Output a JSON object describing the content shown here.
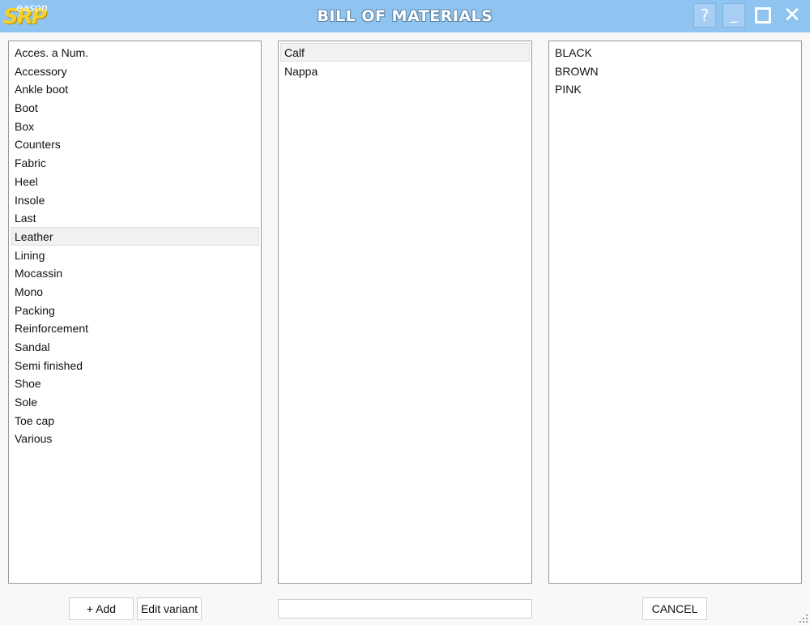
{
  "window": {
    "title": "BILL OF MATERIALS",
    "logo_main": "SRP",
    "logo_sub": "eason",
    "help_label": "?",
    "minimize_label": "_",
    "close_label": "✕"
  },
  "categories": {
    "items": [
      "Acces. a Num.",
      "Accessory",
      "Ankle boot",
      "Boot",
      "Box",
      "Counters",
      "Fabric",
      "Heel",
      "Insole",
      "Last",
      "Leather",
      "Lining",
      "Mocassin",
      "Mono",
      "Packing",
      "Reinforcement",
      "Sandal",
      "Semi finished",
      "Shoe",
      "Sole",
      "Toe cap",
      "Various"
    ],
    "selected": "Leather"
  },
  "materials": {
    "items": [
      "Calf",
      "Nappa"
    ],
    "selected": "Calf"
  },
  "colors": {
    "items": [
      "BLACK",
      "BROWN",
      "PINK"
    ]
  },
  "footer": {
    "add_label": "+ Add",
    "edit_variant_label": "Edit variant",
    "search_value": "",
    "cancel_label": "CANCEL"
  }
}
